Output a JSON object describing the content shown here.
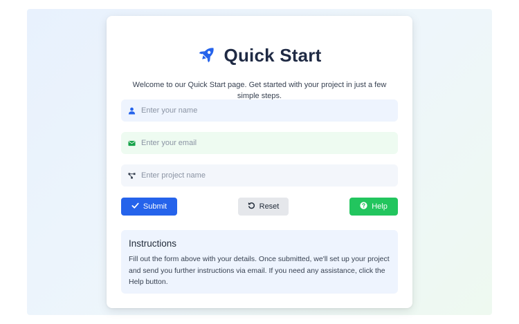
{
  "header": {
    "title": "Quick Start",
    "icon": "rocket-icon",
    "intro": "Welcome to our Quick Start page. Get started with your project in just a few simple steps."
  },
  "form": {
    "name_placeholder": "Enter your name",
    "email_placeholder": "Enter your email",
    "project_placeholder": "Enter project name",
    "name_value": "",
    "email_value": "",
    "project_value": ""
  },
  "buttons": {
    "submit_label": "Submit",
    "reset_label": "Reset",
    "help_label": "Help"
  },
  "instructions": {
    "heading": "Instructions",
    "body": "Fill out the form above with your details. Once submitted, we'll set up your project and send you further instructions via email. If you need any assistance, click the Help button."
  },
  "colors": {
    "primary": "#2563eb",
    "success": "#22c55e",
    "neutral": "#e5e7eb",
    "title_text": "#1f2a44"
  }
}
